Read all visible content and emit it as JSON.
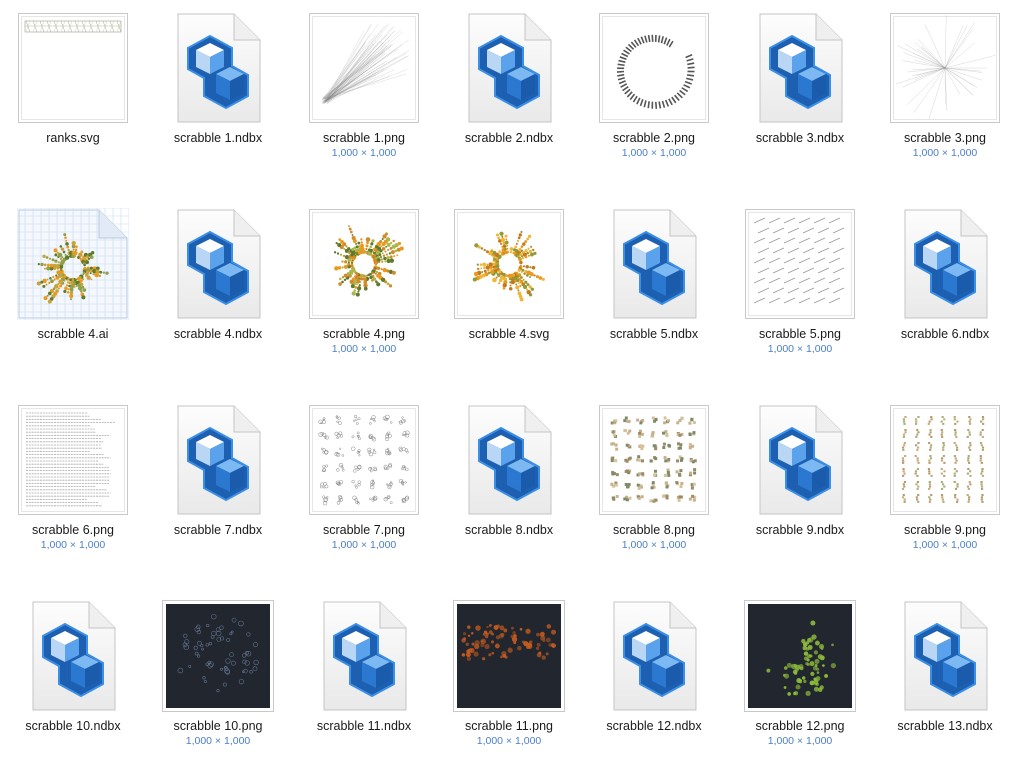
{
  "dimension_text": "1,000 × 1,000",
  "colors": {
    "nodebox_dark": "#1d5fb0",
    "nodebox_light": "#3b8fe6",
    "dims_blue": "#4a7fc8",
    "dark_bg": "#22262f",
    "scrabble_orange": "#e89a1e",
    "scrabble_green": "#5f7a2a"
  },
  "files": [
    {
      "name": "ranks.svg",
      "kind": "svg-ranks",
      "icon": "svg-document-thumbnail"
    },
    {
      "name": "scrabble 1.ndbx",
      "kind": "ndbx",
      "icon": "nodebox-file-icon"
    },
    {
      "name": "scrabble 1.png",
      "kind": "png-lines",
      "dims": "1,000 × 1,000",
      "icon": "png-thumbnail"
    },
    {
      "name": "scrabble 2.ndbx",
      "kind": "ndbx",
      "icon": "nodebox-file-icon"
    },
    {
      "name": "scrabble 2.png",
      "kind": "png-spiral",
      "dims": "1,000 × 1,000",
      "icon": "png-thumbnail"
    },
    {
      "name": "scrabble 3.ndbx",
      "kind": "ndbx",
      "icon": "nodebox-file-icon"
    },
    {
      "name": "scrabble 3.png",
      "kind": "png-star",
      "dims": "1,000 × 1,000",
      "icon": "png-thumbnail"
    },
    {
      "name": "scrabble 4.ai",
      "kind": "ai-radial",
      "icon": "illustrator-file-thumbnail"
    },
    {
      "name": "scrabble 4.ndbx",
      "kind": "ndbx",
      "icon": "nodebox-file-icon"
    },
    {
      "name": "scrabble 4.png",
      "kind": "png-radial",
      "dims": "1,000 × 1,000",
      "icon": "png-thumbnail"
    },
    {
      "name": "scrabble 4.svg",
      "kind": "svg-radial",
      "icon": "svg-document-thumbnail"
    },
    {
      "name": "scrabble 5.ndbx",
      "kind": "ndbx",
      "icon": "nodebox-file-icon"
    },
    {
      "name": "scrabble 5.png",
      "kind": "png-dashes",
      "dims": "1,000 × 1,000",
      "icon": "png-thumbnail"
    },
    {
      "name": "scrabble 6.ndbx",
      "kind": "ndbx",
      "icon": "nodebox-file-icon"
    },
    {
      "name": "scrabble 6.png",
      "kind": "png-text",
      "dims": "1,000 × 1,000",
      "icon": "png-thumbnail"
    },
    {
      "name": "scrabble 7.ndbx",
      "kind": "ndbx",
      "icon": "nodebox-file-icon"
    },
    {
      "name": "scrabble 7.png",
      "kind": "png-blobs",
      "dims": "1,000 × 1,000",
      "icon": "png-thumbnail"
    },
    {
      "name": "scrabble 8.ndbx",
      "kind": "ndbx",
      "icon": "nodebox-file-icon"
    },
    {
      "name": "scrabble 8.png",
      "kind": "png-tiles",
      "dims": "1,000 × 1,000",
      "icon": "png-thumbnail"
    },
    {
      "name": "scrabble 9.ndbx",
      "kind": "ndbx",
      "icon": "nodebox-file-icon"
    },
    {
      "name": "scrabble 9.png",
      "kind": "png-vertical",
      "dims": "1,000 × 1,000",
      "icon": "png-thumbnail"
    },
    {
      "name": "scrabble 10.ndbx",
      "kind": "ndbx",
      "icon": "nodebox-file-icon"
    },
    {
      "name": "scrabble 10.png",
      "kind": "dark-ring",
      "dims": "1,000 × 1,000",
      "icon": "png-thumbnail"
    },
    {
      "name": "scrabble 11.ndbx",
      "kind": "ndbx",
      "icon": "nodebox-file-icon"
    },
    {
      "name": "scrabble 11.png",
      "kind": "dark-band",
      "dims": "1,000 × 1,000",
      "icon": "png-thumbnail"
    },
    {
      "name": "scrabble 12.ndbx",
      "kind": "ndbx",
      "icon": "nodebox-file-icon"
    },
    {
      "name": "scrabble 12.png",
      "kind": "dark-green",
      "dims": "1,000 × 1,000",
      "icon": "png-thumbnail"
    },
    {
      "name": "scrabble 13.ndbx",
      "kind": "ndbx",
      "icon": "nodebox-file-icon"
    }
  ]
}
